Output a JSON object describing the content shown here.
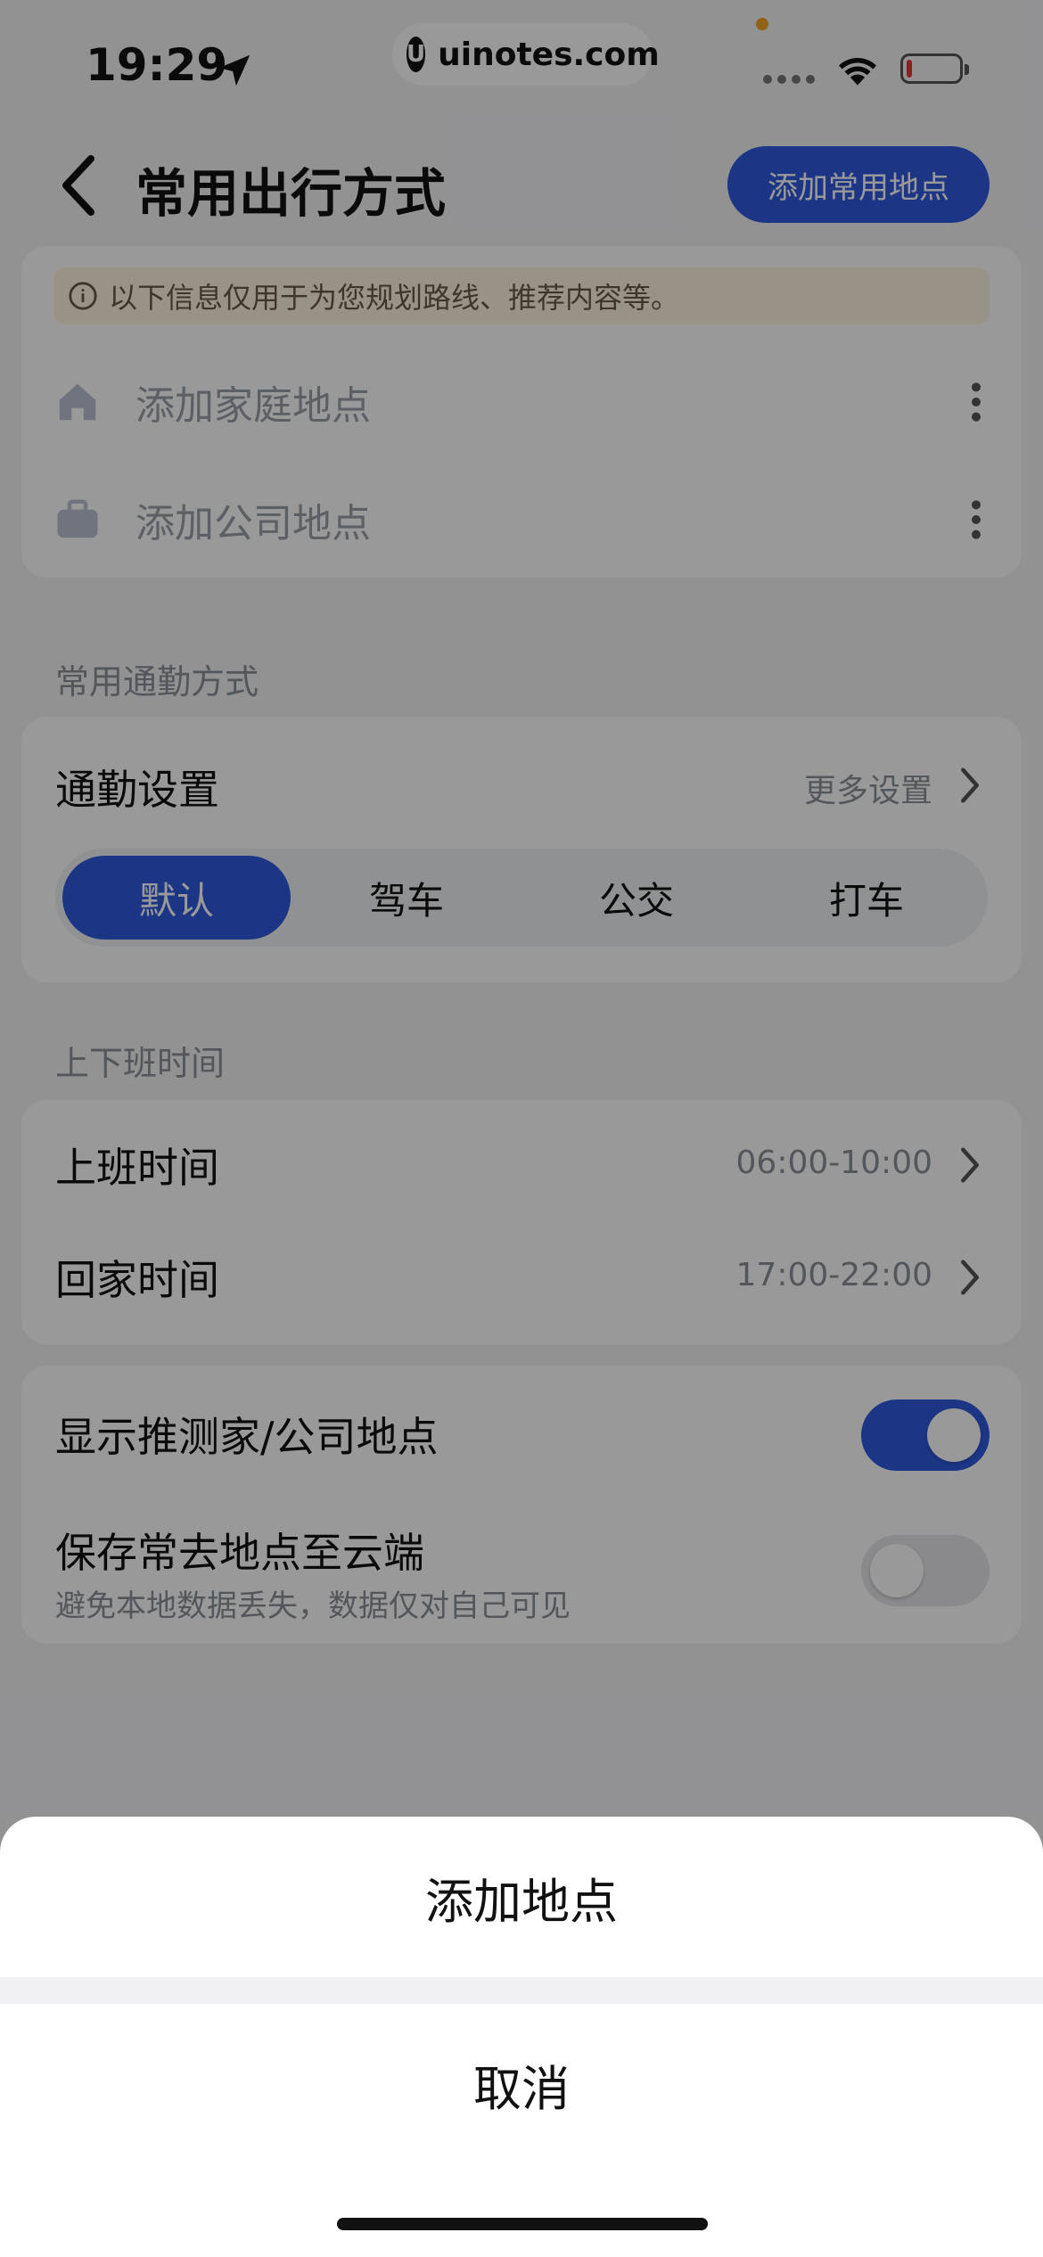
{
  "status_bar": {
    "time": "19:29"
  },
  "watermark": {
    "text": "uinotes.com",
    "logo": "U"
  },
  "header": {
    "title": "常用出行方式",
    "add_button": "添加常用地点"
  },
  "notice": {
    "text": "以下信息仅用于为您规划路线、推荐内容等。"
  },
  "locations": [
    {
      "label": "添加家庭地点",
      "icon": "home-icon"
    },
    {
      "label": "添加公司地点",
      "icon": "briefcase-icon"
    }
  ],
  "commute": {
    "section_label": "常用通勤方式",
    "title": "通勤设置",
    "more": "更多设置",
    "modes": [
      "默认",
      "驾车",
      "公交",
      "打车"
    ],
    "selected": "默认"
  },
  "work_hours": {
    "section_label": "上下班时间",
    "rows": [
      {
        "label": "上班时间",
        "value": "06:00-10:00"
      },
      {
        "label": "回家时间",
        "value": "17:00-22:00"
      }
    ]
  },
  "toggles": [
    {
      "label": "显示推测家/公司地点",
      "on": true
    },
    {
      "label": "保存常去地点至云端",
      "sub": "避免本地数据丢失，数据仅对自己可见",
      "on": false
    }
  ],
  "sheet": {
    "option": "添加地点",
    "cancel": "取消"
  },
  "colors": {
    "accent": "#2f5bde",
    "notice_bg": "#fff3df"
  }
}
